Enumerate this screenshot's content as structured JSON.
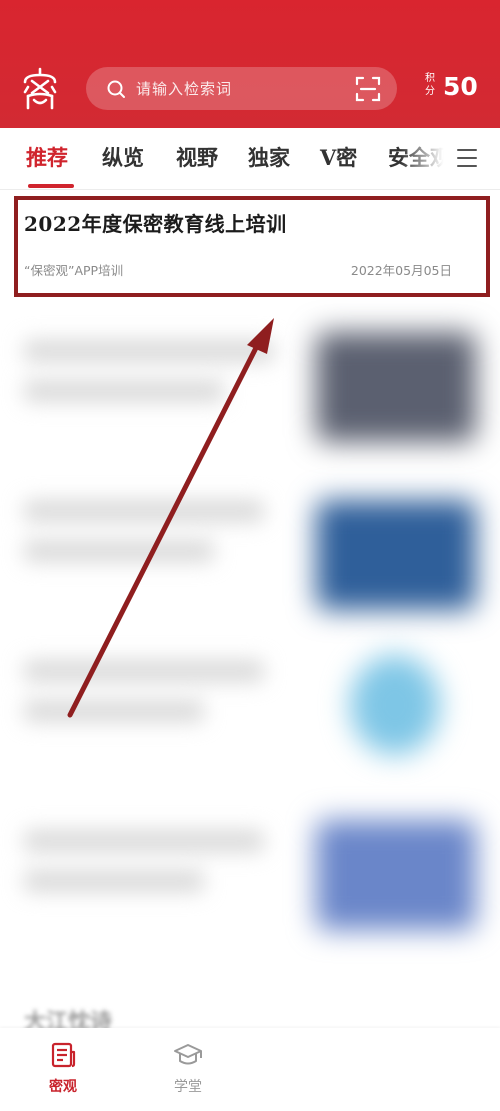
{
  "header": {
    "search_placeholder": "请输入检索词",
    "points_label": "积分",
    "points_value": "50"
  },
  "tabs": [
    {
      "label": "推荐",
      "active": true
    },
    {
      "label": "纵览",
      "active": false
    },
    {
      "label": "视野",
      "active": false
    },
    {
      "label": "独家",
      "active": false
    },
    {
      "label": "V密",
      "active": false
    },
    {
      "label": "安全观",
      "active": false
    }
  ],
  "article": {
    "title": "2022年度保密教育线上培训",
    "source": "“保密观”APP培训",
    "date": "2022年05月05日"
  },
  "feed_section_label": "大江忱诗",
  "bottom_nav": [
    {
      "label": "密观",
      "icon": "news-icon",
      "active": true
    },
    {
      "label": "学堂",
      "icon": "graduation-cap-icon",
      "active": false
    }
  ],
  "colors": {
    "brand_red": "#d9252f",
    "annotation_red": "#8f1e1f"
  }
}
